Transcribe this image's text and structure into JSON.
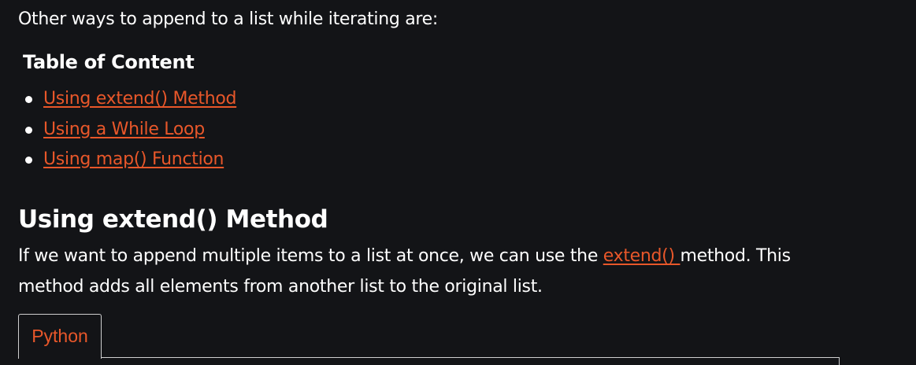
{
  "intro": "Other ways to append to a list while iterating are:",
  "toc": {
    "title": "Table of Content",
    "items": [
      {
        "label": "Using extend() Method"
      },
      {
        "label": "Using a While Loop"
      },
      {
        "label": "Using map() Function"
      }
    ]
  },
  "section": {
    "heading": "Using extend() Method",
    "text_before_link": "If we want to append multiple items to a list at once, we can use the ",
    "link_text": "extend() ",
    "text_after_link": "method. This method adds all elements from another list to the original list."
  },
  "code_block": {
    "tab_label": "Python"
  },
  "colors": {
    "background": "#131417",
    "text": "#ffffff",
    "link": "#e8572a",
    "border": "#cfcfcf"
  }
}
